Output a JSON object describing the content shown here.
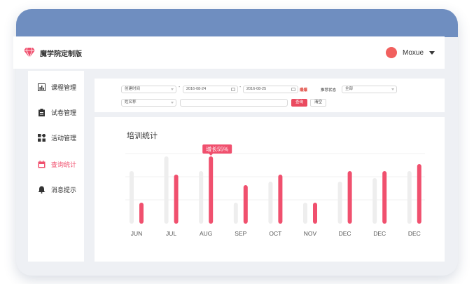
{
  "app": {
    "title": "魔学院定制版"
  },
  "user": {
    "name": "Moxue"
  },
  "sidebar": {
    "items": [
      {
        "label": "课程管理",
        "icon": "bar-chart-icon",
        "active": false
      },
      {
        "label": "试卷管理",
        "icon": "clipboard-icon",
        "active": false
      },
      {
        "label": "活动管理",
        "icon": "grid-icon",
        "active": false
      },
      {
        "label": "查询统计",
        "icon": "calendar-icon",
        "active": true
      },
      {
        "label": "消息提示",
        "icon": "bell-icon",
        "active": false
      }
    ]
  },
  "filters": {
    "created_time_select": "创建时间",
    "date_start": "2016-08-24",
    "date_end": "2016-08-25",
    "hot_tag": "爆爆",
    "status_label": "推荐状态",
    "status_select": "全部",
    "name_select": "姓名称",
    "search_value": "",
    "query_button": "查询",
    "clear_button": "清空"
  },
  "colors": {
    "accent": "#f0506e",
    "bar_gray": "#eeeeee",
    "header": "#6f8ec0"
  },
  "chart_data": {
    "type": "bar",
    "title": "培训统计",
    "categories": [
      "JUN",
      "JUL",
      "AUG",
      "SEP",
      "OCT",
      "NOV",
      "DEC",
      "DEC",
      "DEC"
    ],
    "series": [
      {
        "values": [
          75,
          96,
          75,
          30,
          60,
          30,
          60,
          65,
          75
        ]
      },
      {
        "values": [
          30,
          70,
          96,
          55,
          70,
          30,
          75,
          75,
          85
        ]
      }
    ],
    "ylim": [
      0,
      100
    ],
    "annotation": {
      "text": "增长55%",
      "category_index": 2
    },
    "grid": true
  }
}
